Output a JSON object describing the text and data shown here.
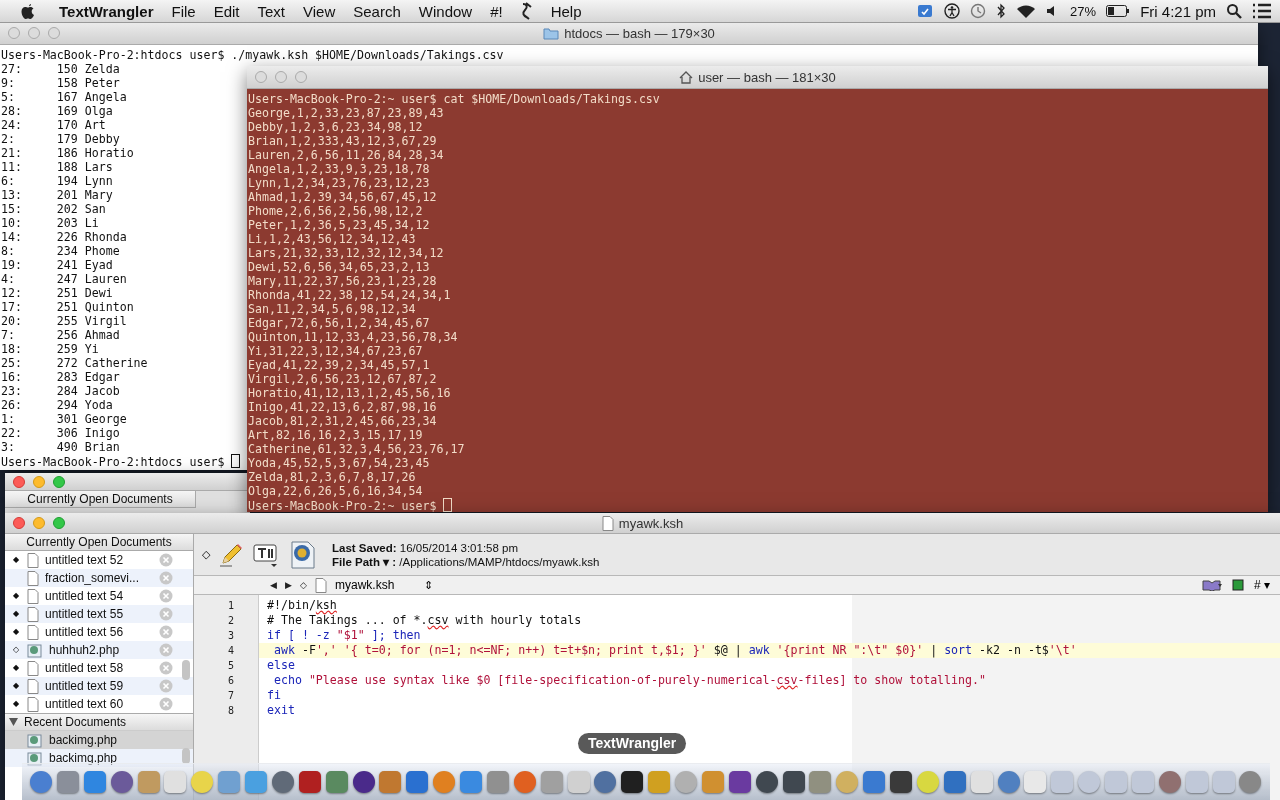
{
  "menu_bar": {
    "app": "TextWrangler",
    "items": [
      {
        "kind": "menu",
        "label": "File"
      },
      {
        "kind": "menu",
        "label": "Edit"
      },
      {
        "kind": "menu",
        "label": "Text"
      },
      {
        "kind": "menu",
        "label": "View"
      },
      {
        "kind": "menu",
        "label": "Search"
      },
      {
        "kind": "menu",
        "label": "Window"
      },
      {
        "kind": "menu",
        "label": "#!"
      },
      {
        "kind": "icon"
      },
      {
        "kind": "menu",
        "label": "Help"
      }
    ],
    "battery": "27%",
    "clock": "Fri 4:21 pm"
  },
  "terminal_back": {
    "title": "htdocs — bash — 179×30",
    "command": "Users-MacBook-Pro-2:htdocs user$ ./myawk.ksh $HOME/Downloads/Takings.csv",
    "lines": [
      "27:     150 Zelda",
      "9:      158 Peter",
      "5:      167 Angela",
      "28:     169 Olga",
      "24:     170 Art",
      "2:      179 Debby",
      "21:     186 Horatio",
      "11:     188 Lars",
      "6:      194 Lynn",
      "13:     201 Mary",
      "15:     202 San",
      "10:     203 Li",
      "14:     226 Rhonda",
      "8:      234 Phome",
      "19:     241 Eyad",
      "4:      247 Lauren",
      "12:     251 Dewi",
      "17:     251 Quinton",
      "20:     255 Virgil",
      "7:      256 Ahmad",
      "18:     259 Yi",
      "25:     272 Catherine",
      "16:     283 Edgar",
      "23:     284 Jacob",
      "26:     294 Yoda",
      "1:      301 George",
      "22:     306 Inigo",
      "3:      490 Brian"
    ],
    "prompt": "Users-MacBook-Pro-2:htdocs user$"
  },
  "terminal_front": {
    "title": "user — bash — 181×30",
    "command": "Users-MacBook-Pro-2:~ user$ cat $HOME/Downloads/Takings.csv",
    "lines": [
      "George,1,2,33,23,87,23,89,43",
      "Debby,1,2,3,6,23,34,98,12",
      "Brian,1,2,333,43,12,3,67,29",
      "Lauren,2,6,56,11,26,84,28,34",
      "Angela,1,2,33,9,3,23,18,78",
      "Lynn,1,2,34,23,76,23,12,23",
      "Ahmad,1,2,39,34,56,67,45,12",
      "Phome,2,6,56,2,56,98,12,2",
      "Peter,1,2,36,5,23,45,34,12",
      "Li,1,2,43,56,12,34,12,43",
      "Lars,21,32,33,12,32,12,34,12",
      "Dewi,52,6,56,34,65,23,2,13",
      "Mary,11,22,37,56,23,1,23,28",
      "Rhonda,41,22,38,12,54,24,34,1",
      "San,11,2,34,5,6,98,12,34",
      "Edgar,72,6,56,1,2,34,45,67",
      "Quinton,11,12,33,4,23,56,78,34",
      "Yi,31,22,3,12,34,67,23,67",
      "Eyad,41,22,39,2,34,45,57,1",
      "Virgil,2,6,56,23,12,67,87,2",
      "Horatio,41,12,13,1,2,45,56,16",
      "Inigo,41,22,13,6,2,87,98,16",
      "Jacob,81,2,31,2,45,66,23,34",
      "Art,82,16,16,2,3,15,17,19",
      "Catherine,61,32,3,4,56,23,76,17",
      "Yoda,45,52,5,3,67,54,23,45",
      "Zelda,81,2,3,6,7,8,17,26",
      "Olga,22,6,26,5,6,16,34,54"
    ],
    "prompt": "Users-MacBook-Pro-2:~ user$"
  },
  "background_editor": {
    "sidebar_header": "Currently Open Documents"
  },
  "editor": {
    "title": "myawk.ksh",
    "sidebar": {
      "open_header": "Currently Open Documents",
      "open_documents": [
        {
          "name": "untitled text 52",
          "kind": "text",
          "mark": "◆"
        },
        {
          "name": "fraction_somevi...",
          "kind": "text"
        },
        {
          "name": "untitled text 54",
          "kind": "text",
          "mark": "◆"
        },
        {
          "name": "untitled text 55",
          "kind": "text",
          "mark": "◆"
        },
        {
          "name": "untitled text 56",
          "kind": "text",
          "mark": "◆"
        },
        {
          "name": "huhhuh2.php",
          "kind": "php",
          "mark": "◇"
        },
        {
          "name": "untitled text 58",
          "kind": "text",
          "mark": "◆"
        },
        {
          "name": "untitled text 59",
          "kind": "text",
          "mark": "◆"
        },
        {
          "name": "untitled text 60",
          "kind": "text",
          "mark": "◆"
        }
      ],
      "recent_header": "Recent Documents",
      "recent_expanded": true,
      "recent_documents": [
        {
          "name": "backimg.php",
          "selected": true
        },
        {
          "name": "backimg.php",
          "selected": false
        }
      ]
    },
    "toolbar": {
      "state_mark": "◇",
      "last_saved_label": "Last Saved:",
      "last_saved": "16/05/2014 3:01:58 pm",
      "file_path_label": "File Path ▾ :",
      "file_path": "/Applications/MAMP/htdocs/myawk.ksh"
    },
    "navbar": {
      "back": "◀",
      "forward": "▶",
      "state_mark": "◇",
      "file": "myawk.ksh",
      "updown": "⇕",
      "counter_menu": "# ▾"
    },
    "lines": [
      {
        "number": "1",
        "current": false,
        "tokens": [
          {
            "text": "#!/bin/",
            "kind": "plain"
          },
          {
            "text": "ksh",
            "kind": "typo"
          }
        ]
      },
      {
        "number": "2",
        "current": false,
        "tokens": [
          {
            "text": "# The Takings ... of *.",
            "kind": "plain"
          },
          {
            "text": "csv",
            "kind": "typo"
          },
          {
            "text": " with hourly totals",
            "kind": "plain"
          }
        ]
      },
      {
        "number": "3",
        "current": false,
        "tokens": [
          {
            "text": "if [ ! -z ",
            "kind": "keyword"
          },
          {
            "text": "\"$1\"",
            "kind": "string"
          },
          {
            "text": " ]; then",
            "kind": "keyword"
          }
        ]
      },
      {
        "number": "4",
        "current": true,
        "tokens": [
          {
            "text": " awk",
            "kind": "keyword"
          },
          {
            "text": " -F",
            "kind": "plain"
          },
          {
            "text": "','",
            "kind": "string"
          },
          {
            "text": " '{ t=0; for (n=1; n<=NF; n++) t=t+$n; print t,$1; }'",
            "kind": "string"
          },
          {
            "text": " $@ | ",
            "kind": "plain"
          },
          {
            "text": "awk",
            "kind": "keyword"
          },
          {
            "text": " '{print NR \":\\t\" $0}'",
            "kind": "string"
          },
          {
            "text": " | ",
            "kind": "plain"
          },
          {
            "text": "sort",
            "kind": "keyword"
          },
          {
            "text": " -k2 -n -t$",
            "kind": "plain"
          },
          {
            "text": "'\\t'",
            "kind": "string"
          }
        ]
      },
      {
        "number": "5",
        "current": false,
        "tokens": [
          {
            "text": "else",
            "kind": "keyword"
          }
        ]
      },
      {
        "number": "6",
        "current": false,
        "tokens": [
          {
            "text": " echo",
            "kind": "keyword"
          },
          {
            "text": " \"Please use syntax like $0 [file-specification-of-purely-numerical-",
            "kind": "string"
          },
          {
            "text": "csv",
            "kind": "stringtypo"
          },
          {
            "text": "-files] to show totalling.\"",
            "kind": "string"
          }
        ]
      },
      {
        "number": "7",
        "current": false,
        "tokens": [
          {
            "text": "fi",
            "kind": "keyword"
          }
        ]
      },
      {
        "number": "8",
        "current": false,
        "tokens": [
          {
            "text": "exit",
            "kind": "keyword"
          }
        ]
      }
    ]
  },
  "dock": {
    "tooltip": "TextWrangler"
  }
}
